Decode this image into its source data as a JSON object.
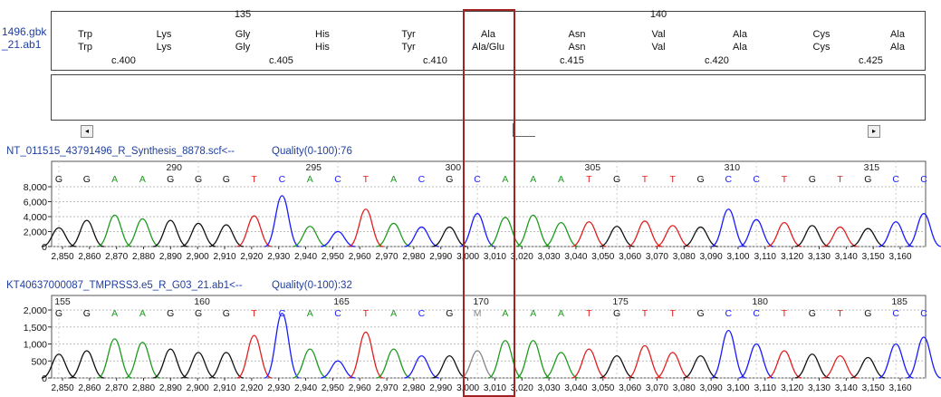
{
  "sequence_names": [
    "1496.gbk",
    "_21.ab1"
  ],
  "protein": {
    "positions": [
      {
        "num": "",
        "ref": "Trp",
        "sample": "Trp"
      },
      {
        "num": "",
        "ref": "Lys",
        "sample": "Lys"
      },
      {
        "num": "135",
        "ref": "Gly",
        "sample": "Gly"
      },
      {
        "num": "",
        "ref": "His",
        "sample": "His"
      },
      {
        "num": "",
        "ref": "Tyr",
        "sample": "Tyr"
      },
      {
        "num": "",
        "ref": "Ala",
        "sample": "Ala/Glu"
      },
      {
        "num": "",
        "ref": "Asn",
        "sample": "Asn"
      },
      {
        "num": "140",
        "ref": "Val",
        "sample": "Val"
      },
      {
        "num": "",
        "ref": "Ala",
        "sample": "Ala"
      },
      {
        "num": "",
        "ref": "Cys",
        "sample": "Cys"
      },
      {
        "num": "",
        "ref": "Ala",
        "sample": "Ala"
      }
    ],
    "cdna_labels": [
      "c.400",
      "c.405",
      "c.410",
      "c.415",
      "c.420",
      "c.425"
    ]
  },
  "scroll": {
    "left_arrow": "◂",
    "right_arrow": "▸"
  },
  "trace1": {
    "name": "NT_011515_43791496_R_Synthesis_8878.scf<--",
    "quality": "Quality(0-100):76",
    "y_ticks": [
      "8,000",
      "6,000",
      "4,000",
      "2,000",
      "0"
    ],
    "ymax": 8000,
    "base_numbers": [
      {
        "label": "290",
        "at": 4
      },
      {
        "label": "295",
        "at": 9
      },
      {
        "label": "300",
        "at": 14
      },
      {
        "label": "305",
        "at": 19
      },
      {
        "label": "310",
        "at": 24
      },
      {
        "label": "315",
        "at": 29
      }
    ],
    "bases": [
      "G",
      "G",
      "A",
      "A",
      "G",
      "G",
      "G",
      "T",
      "C",
      "A",
      "C",
      "T",
      "A",
      "C",
      "G",
      "C",
      "A",
      "A",
      "A",
      "T",
      "G",
      "T",
      "T",
      "G",
      "C",
      "C",
      "T",
      "G",
      "T",
      "G",
      "C",
      "C"
    ],
    "peaks": [
      2500,
      3500,
      4200,
      3700,
      3500,
      3100,
      2900,
      4100,
      6800,
      2700,
      2000,
      5000,
      3100,
      2600,
      2600,
      4400,
      3900,
      4200,
      3200,
      3300,
      2700,
      3400,
      2800,
      2600,
      5000,
      3600,
      3200,
      2800,
      2600,
      2400,
      3300,
      4400
    ]
  },
  "trace2": {
    "name": "KT40637000087_TMPRSS3.e5_R_G03_21.ab1<--",
    "quality": "Quality(0-100):32",
    "y_ticks": [
      "2,000",
      "1,500",
      "1,000",
      "500",
      "0"
    ],
    "ymax": 2000,
    "base_numbers": [
      {
        "label": "155",
        "at": 0
      },
      {
        "label": "160",
        "at": 5
      },
      {
        "label": "165",
        "at": 10
      },
      {
        "label": "170",
        "at": 15
      },
      {
        "label": "175",
        "at": 20
      },
      {
        "label": "180",
        "at": 25
      },
      {
        "label": "185",
        "at": 30
      }
    ],
    "bases": [
      "G",
      "G",
      "A",
      "A",
      "G",
      "G",
      "G",
      "T",
      "C",
      "A",
      "C",
      "T",
      "A",
      "C",
      "G",
      "M",
      "A",
      "A",
      "A",
      "T",
      "G",
      "T",
      "T",
      "G",
      "C",
      "C",
      "T",
      "G",
      "T",
      "G",
      "C",
      "C"
    ],
    "peaks": [
      700,
      800,
      1150,
      1050,
      850,
      750,
      750,
      1250,
      1900,
      850,
      500,
      1350,
      850,
      650,
      650,
      800,
      1100,
      1100,
      750,
      850,
      650,
      950,
      750,
      650,
      1400,
      1000,
      800,
      700,
      650,
      600,
      1000,
      1200
    ]
  },
  "x_axis_labels": [
    "2,850",
    "2,860",
    "2,870",
    "2,880",
    "2,890",
    "2,900",
    "2,910",
    "2,920",
    "2,930",
    "2,940",
    "2,950",
    "2,960",
    "2,970",
    "2,980",
    "2,990",
    "3,000",
    "3,010",
    "3,020",
    "3,030",
    "3,040",
    "3,050",
    "3,060",
    "3,070",
    "3,080",
    "3,090",
    "3,100",
    "3,110",
    "3,120",
    "3,130",
    "3,140",
    "3,150",
    "3,160"
  ],
  "colors": {
    "A": "#1e9a1e",
    "C": "#1a1aff",
    "G": "#111111",
    "T": "#e02020",
    "M": "#888888",
    "highlight": "#a32222",
    "label": "#1f3f9f"
  }
}
